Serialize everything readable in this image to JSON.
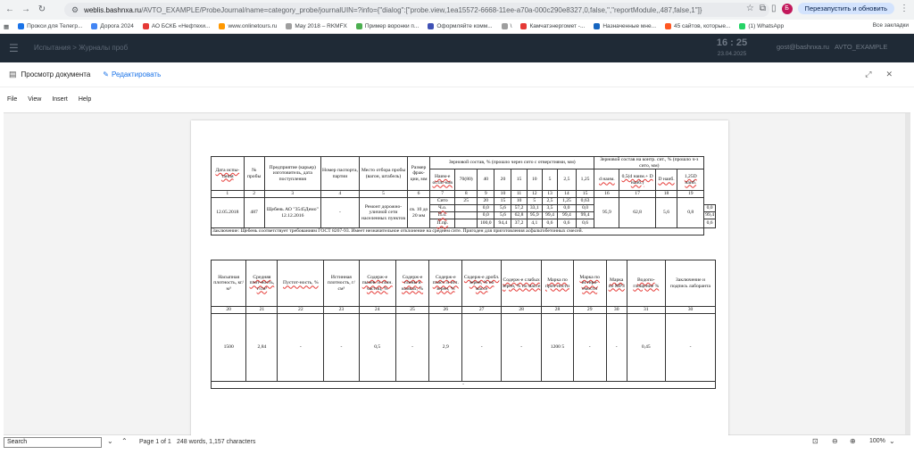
{
  "browser": {
    "url_host": "weblis.bashnxa.ru",
    "url_path": "/AVTO_EXAMPLE/ProbeJournal/name=category_probe/journalUIN=?info={\"dialog\":[\"probe.view,1ea15572-6668-11ee-a70a-000c290e8327,0,false,\",\"reportModule,,487,false,1\"]}",
    "profile_letter": "Б",
    "relaunch_label": "Перезапустить и обновить",
    "bookmarks": [
      {
        "label": "Прокси для Телегр...",
        "color": "#1a73e8"
      },
      {
        "label": "Дорога 2024",
        "color": "#4285f4"
      },
      {
        "label": "АО БСКБ «Нефтехи...",
        "color": "#e53935"
      },
      {
        "label": "www.onlinetours.ru",
        "color": "#ff9800"
      },
      {
        "label": "May 2018 – RKMFX",
        "color": "#9e9e9e"
      },
      {
        "label": "Пример воронки п...",
        "color": "#4caf50"
      },
      {
        "label": "Оформляйте комм...",
        "color": "#3f51b5"
      },
      {
        "label": "\\",
        "color": "#9e9e9e"
      },
      {
        "label": "Камчатэнергомет -...",
        "color": "#e53935"
      },
      {
        "label": "Назначенные мне...",
        "color": "#1565c0"
      },
      {
        "label": "45 сайтов, которые...",
        "color": "#ff5722"
      },
      {
        "label": "(1) WhatsApp",
        "color": "#25d366"
      }
    ],
    "bookmarks_end": "Все закладки"
  },
  "app_header": {
    "crumb": "Испытания > Журналы проб",
    "time": "16 : 25",
    "date": "23.04.2025",
    "user": "gost@bashnxa.ru",
    "org": "AVTO_EXAMPLE"
  },
  "viewer": {
    "title": "Просмотр документа",
    "edit_label": "Редактировать",
    "menu": [
      "File",
      "View",
      "Insert",
      "Help"
    ]
  },
  "table1": {
    "h_date": "Дата испы-тания",
    "h_no": "№ пробы",
    "h_plant": "Предприятие (карьер) изготовитель, дата поступления",
    "h_passport": "Номер паспорта, партии",
    "h_place": "Место отбора пробы (вагон, штабель)",
    "h_size": "Размер фрак-ции, мм",
    "h_grain": "Зерновой состав, % (прошло через сито с отверстиями, мм)",
    "h_grain_ctrl": "Зерновой состав на контр. сит., % (прошло ч-з сито, мм)",
    "h_naim": "Наим-е остат-ков",
    "sieves": [
      "70(80)",
      "40",
      "20",
      "15",
      "10",
      "5",
      "2,5",
      "1,25"
    ],
    "ctrl": [
      "d наим.",
      "0,5(d наим.+ D наиб.)",
      "D наиб.",
      "1,25D наиб."
    ],
    "nums": [
      "1",
      "2",
      "3",
      "4",
      "5",
      "6",
      "7",
      "8",
      "9",
      "10",
      "11",
      "12",
      "13",
      "14",
      "15",
      "16",
      "17",
      "18",
      "19"
    ],
    "date": "12.05.2018",
    "no": "487",
    "plant": "Щебень АО \"3545Демо\" 12.12.2016",
    "passport": "-",
    "place": "Ремонт дорожно-уличной сети населенных пунктов",
    "size": "св. 10 до 20 мм",
    "rows": [
      {
        "label": "Сито",
        "vals": [
          "25",
          "20",
          "15",
          "10",
          "5",
          "2,5",
          "1,25",
          "0,63"
        ]
      },
      {
        "label": "Ч.о.",
        "vals": [
          "",
          "0,0",
          "5,6",
          "57,2",
          "33,1",
          "3,5",
          "0,0",
          "0,0",
          "0,0"
        ]
      },
      {
        "label": "П.о.",
        "vals": [
          "",
          "0,0",
          "5,6",
          "62,8",
          "95,9",
          "99,4",
          "99,4",
          "99,4",
          "99,4"
        ]
      },
      {
        "label": "П.пр.",
        "vals": [
          "",
          "100,0",
          "94,4",
          "37,2",
          "4,1",
          "0,6",
          "0,6",
          "0,6",
          "0,6"
        ]
      }
    ],
    "ctrl_vals": [
      "95,9",
      "62,8",
      "5,6",
      "0,8"
    ],
    "conclusion": "Заключение: Щебень соответствует требованиям ГОСТ 8267-93. Имеет незначительное отклонение на среднем сите. Пригоден для приготовления асфальтобетонных смесей."
  },
  "table2": {
    "headers": [
      "Насыпная плотность, кг/м³",
      "Средняя плот-ность, г/см³",
      "Пустот-ность, %",
      "Истинная плотность, г/см³",
      "Содерж-е пылев. и глин. частиц, %",
      "Содерж-е глины в комках, %",
      "Содерж-е пласт. и игл. зерен, %",
      "Содерж-е дробл. зерен, % по массе",
      "Содерж-е слабых зерен, % по массе",
      "Марка по проч-ности",
      "Марка по истира-емости",
      "Марка по МРЗ",
      "Водопо-глощение %",
      "Заключение и подпись лаборанта"
    ],
    "nums": [
      "20",
      "21",
      "22",
      "23",
      "24",
      "25",
      "26",
      "27",
      "28",
      "28",
      "29",
      "30",
      "31",
      "30"
    ],
    "values": [
      "1500",
      "2,84",
      "-",
      "-",
      "0,5",
      "-",
      "2,9",
      "-",
      "-",
      "1200 5",
      "-",
      "-",
      "0,45",
      "-"
    ],
    "footer": "-"
  },
  "findbar": {
    "search_placeholder": "Search",
    "page_info": "Page 1 of 1",
    "counts": "248 words, 1,157 characters",
    "zoom": "100%"
  }
}
